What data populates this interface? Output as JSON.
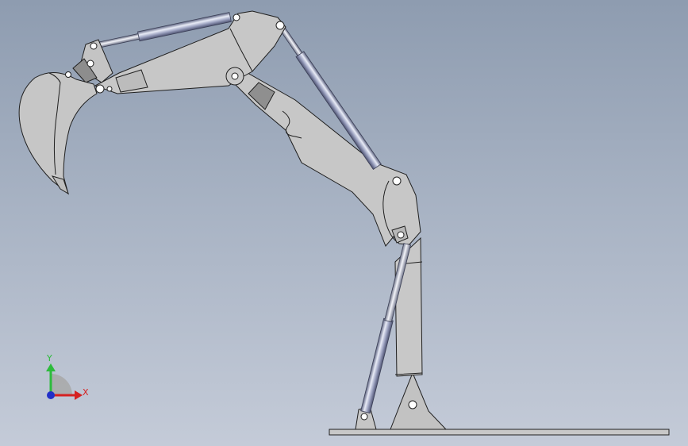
{
  "triad": {
    "y_label": "Y",
    "x_label": "X",
    "y_color": "#2dbb3c",
    "x_color": "#d52121",
    "z_color": "#2230c8"
  },
  "colors": {
    "body_fill": "#c6c6c6",
    "body_stroke": "#1f1f1f",
    "dark_fill": "#8d8d8d",
    "ground_fill": "#c8c8c8",
    "cylinder_light": "#e9ecf7",
    "cylinder_mid": "#9ea4c2",
    "cylinder_dark": "#5d6381"
  }
}
